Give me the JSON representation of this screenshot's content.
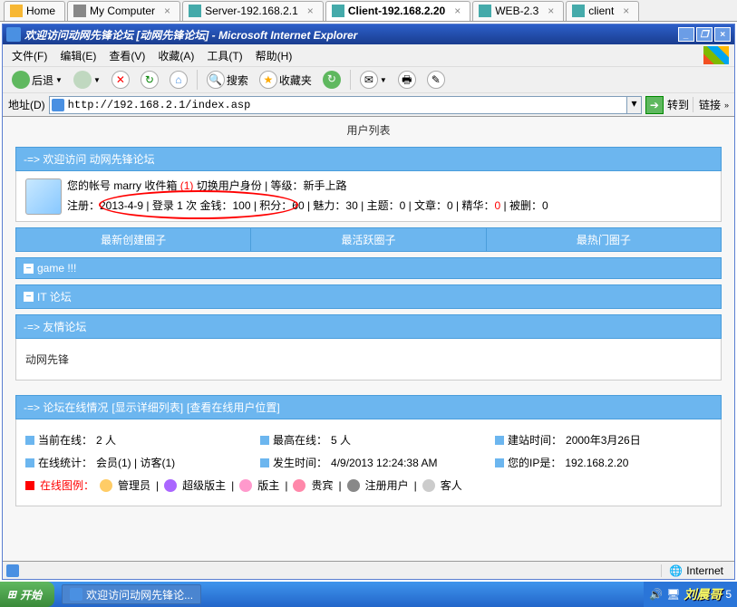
{
  "vm_tabs": [
    {
      "label": "Home",
      "active": false
    },
    {
      "label": "My Computer",
      "active": false
    },
    {
      "label": "Server-192.168.2.1",
      "active": false
    },
    {
      "label": "Client-192.168.2.20",
      "active": true
    },
    {
      "label": "WEB-2.3",
      "active": false
    },
    {
      "label": "client",
      "active": false
    }
  ],
  "window": {
    "title": "欢迎访问动网先锋论坛 [动网先锋论坛] - Microsoft Internet Explorer"
  },
  "menu": {
    "file": "文件(F)",
    "edit": "编辑(E)",
    "view": "查看(V)",
    "fav": "收藏(A)",
    "tools": "工具(T)",
    "help": "帮助(H)"
  },
  "toolbar": {
    "back": "后退",
    "search": "搜索",
    "favorites": "收藏夹"
  },
  "addressbar": {
    "label": "地址(D)",
    "url": "http://192.168.2.1/index.asp",
    "go": "转到",
    "links": "链接"
  },
  "page": {
    "user_list_link": "用户列表",
    "welcome_header": "-=> 欢迎访问 动网先锋论坛",
    "account_line_prefix": "您的帐号 ",
    "account_name": "marry",
    "inbox_label": "收件箱 ",
    "inbox_count": "(1)",
    "switch_user": " 切换用户身份",
    "level_label": " | 等级：",
    "level_value": "新手上路",
    "stats_line": "注册：2013-4-9 | 登录 1 次 金钱：100 | 积分：60 | 魅力：30 | 主题：0 | 文章：0 | 精华：",
    "essence_count": "0",
    "stats_tail": " | 被删：0",
    "circles": {
      "newest": "最新创建圈子",
      "active": "最活跃圈子",
      "hot": "最热门圈子"
    },
    "sections": {
      "game": "game !!!",
      "it": "IT 论坛",
      "friend": "-=> 友情论坛",
      "friend_body": "动网先锋"
    },
    "online": {
      "header": "-=> 论坛在线情况 ",
      "show_detail": "[显示详细列表]",
      "show_loc": " [查看在线用户位置]",
      "current": "当前在线：",
      "current_v": "2 人",
      "max": "最高在线：",
      "max_v": "5 人",
      "since": "建站时间：",
      "since_v": "2000年3月26日",
      "stat": "在线统计：",
      "stat_v": "会员(1) | 访客(1)",
      "time": "发生时间：",
      "time_v": "4/9/2013 12:24:38 AM",
      "ip": "您的IP是：",
      "ip_v": "192.168.2.20",
      "legend_label": "在线图例：",
      "roles": {
        "admin": "管理员",
        "smod": "超级版主",
        "mod": "版主",
        "vip": "贵宾",
        "user": "注册用户",
        "guest": "客人"
      }
    }
  },
  "status": {
    "zone": "Internet"
  },
  "taskbar": {
    "start": "开始",
    "app": "欢迎访问动网先锋论...",
    "user": "刘晨哥",
    "time": "5"
  }
}
